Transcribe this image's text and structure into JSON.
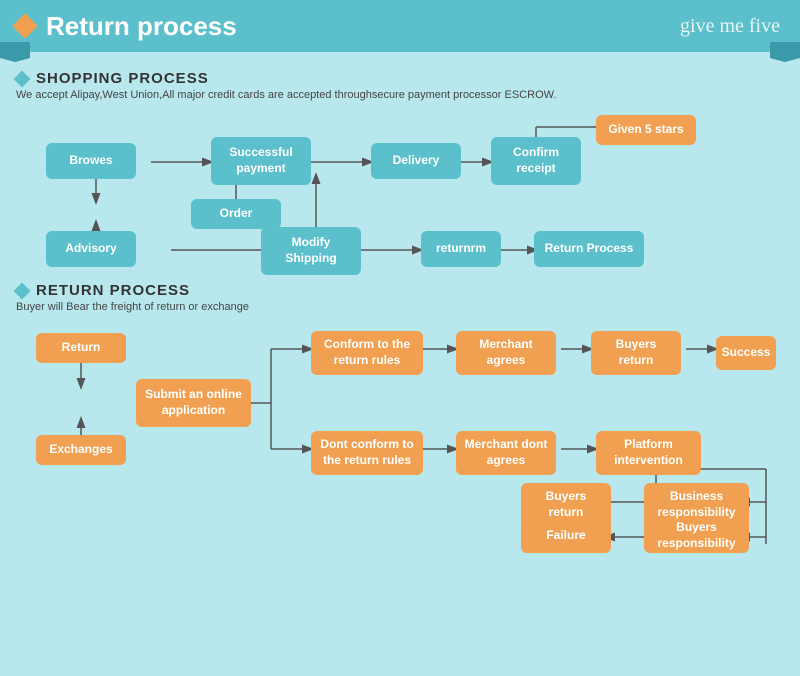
{
  "header": {
    "title": "Return process",
    "logo": "give me five",
    "diamond_color": "#f0a050"
  },
  "shopping_section": {
    "title": "SHOPPING PROCESS",
    "desc": "We accept Alipay,West Union,All major credit cards are accepted throughsecure payment processor ESCROW.",
    "boxes": {
      "browes": "Browes",
      "order": "Order",
      "advisory": "Advisory",
      "successful_payment": "Successful\npayment",
      "modify_shipping": "Modify\nShipping",
      "delivery": "Delivery",
      "confirm_receipt": "Confirm\nreceipt",
      "given_5_stars": "Given 5 stars",
      "returnrm": "returnrm",
      "return_process": "Return Process"
    }
  },
  "return_section": {
    "title": "RETURN PROCESS",
    "desc": "Buyer will Bear the freight of return or exchange",
    "boxes": {
      "return_btn": "Return",
      "exchanges": "Exchanges",
      "submit_application": "Submit an online\napplication",
      "conform_rules": "Conform to the\nreturn rules",
      "dont_conform_rules": "Dont conform to the\nreturn rules",
      "merchant_agrees": "Merchant\nagrees",
      "merchant_dont": "Merchant\ndont agrees",
      "buyers_return1": "Buyers\nreturn",
      "buyers_return2": "Buyers\nreturn",
      "platform_intervention": "Platform\nintervention",
      "success": "Success",
      "business_responsibility": "Business\nresponsibility",
      "buyers_responsibility": "Buyers\nresponsibility",
      "failure": "Failure"
    }
  }
}
